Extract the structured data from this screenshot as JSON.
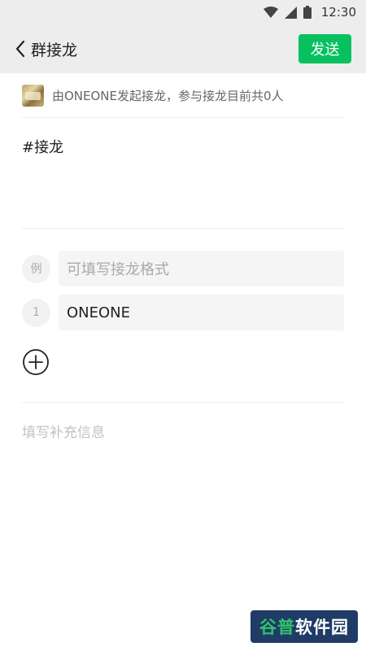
{
  "status_bar": {
    "time": "12:30",
    "icons": [
      "wifi-icon",
      "signal-icon",
      "battery-icon"
    ]
  },
  "nav": {
    "back_icon": "chevron-left-icon",
    "title": "群接龙",
    "send_label": "发送"
  },
  "initiator": {
    "text": "由ONEONE发起接龙，参与接龙目前共0人"
  },
  "topic": {
    "text": "#接龙"
  },
  "entries": {
    "example": {
      "index": "例",
      "placeholder": "可填写接龙格式"
    },
    "items": [
      {
        "index": "1",
        "value": "ONEONE"
      }
    ],
    "add_icon": "plus-circle-icon"
  },
  "supplement": {
    "placeholder": "填写补充信息"
  },
  "watermark": {
    "part1": "谷普",
    "part2": "软件园"
  },
  "colors": {
    "accent": "#07c160",
    "bar_background": "#ededed"
  }
}
